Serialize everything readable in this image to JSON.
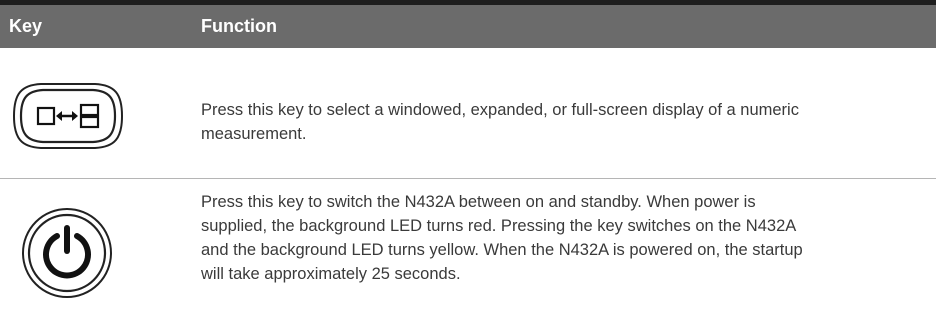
{
  "table": {
    "header": {
      "key": "Key",
      "function": "Function"
    },
    "rows": [
      {
        "key_icon": "window-toggle-icon",
        "function": "Press this key to select a windowed, expanded, or full-screen display of a numeric\nmeasurement."
      },
      {
        "key_icon": "power-icon",
        "function": "Press this key to switch the N432A between on and standby. When power is\nsupplied, the background LED turns red. Pressing the key switches on the N432A\nand the background LED turns yellow. When the N432A is powered on, the startup\nwill take approximately 25 seconds."
      }
    ]
  },
  "colors": {
    "header_bg": "#6b6b6b",
    "header_text": "#ffffff",
    "body_text": "#3a3a3a",
    "rule": "#1e1e1e",
    "divider": "#b5b5b5"
  }
}
